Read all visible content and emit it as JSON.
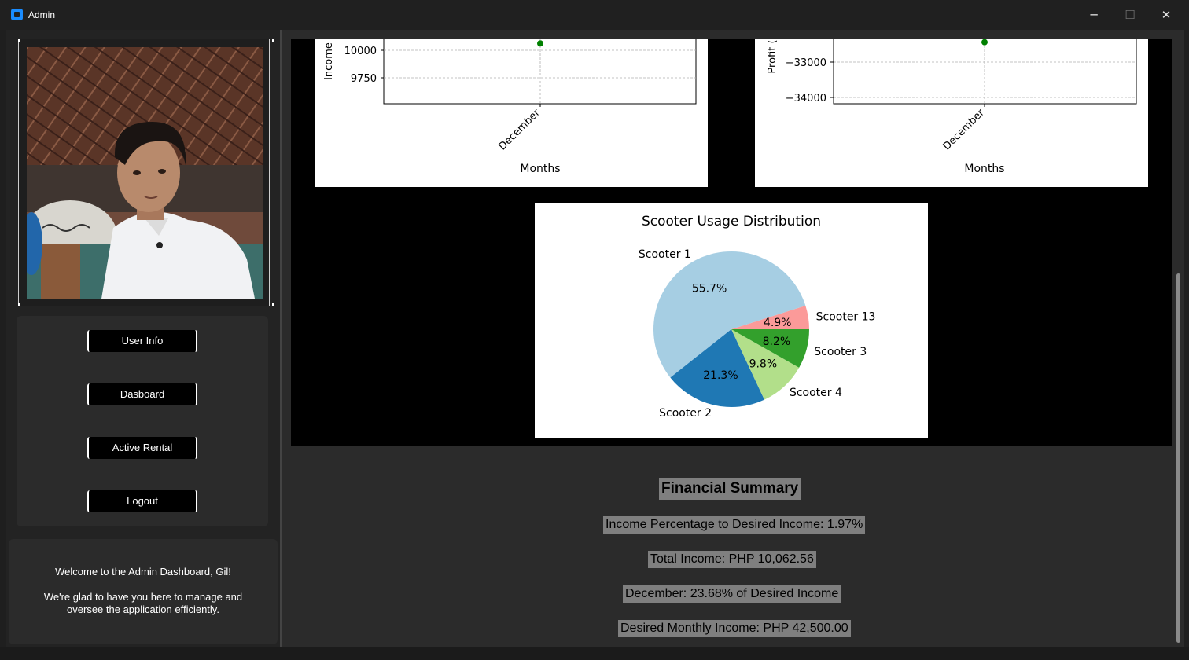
{
  "window": {
    "title": "Admin",
    "minimize_glyph": "─",
    "maximize_glyph": "☐",
    "close_glyph": "✕"
  },
  "sidebar": {
    "profile_photo_alt": "Admin profile photo",
    "nav": [
      {
        "label": "User Info"
      },
      {
        "label": "Dasboard"
      },
      {
        "label": "Active Rental"
      },
      {
        "label": "Logout"
      }
    ],
    "welcome_line1": "Welcome to the Admin Dashboard, Gil!",
    "welcome_line2": "We're glad to have you here to manage and oversee the application efficiently."
  },
  "chart_data": [
    {
      "type": "line",
      "title": "",
      "ylabel": "Income",
      "xlabel": "Months",
      "x": [
        "December"
      ],
      "series": [
        {
          "values": [
            10062.56
          ],
          "color": "#008000"
        }
      ],
      "y_ticks": [
        9750,
        10000
      ],
      "grid": true
    },
    {
      "type": "line",
      "title": "",
      "ylabel": "Profit (",
      "xlabel": "Months",
      "x": [
        "December"
      ],
      "series": [
        {
          "values": [
            -32437.44
          ],
          "color": "#008000"
        }
      ],
      "y_ticks": [
        -34000,
        -33000
      ],
      "y_tick_labels": [
        "−34000",
        "−33000"
      ],
      "grid": true
    },
    {
      "type": "pie",
      "title": "Scooter Usage Distribution",
      "slices": [
        {
          "label": "Scooter 1",
          "value": 55.7,
          "pct_label": "55.7%",
          "color": "#a6cee3"
        },
        {
          "label": "Scooter 2",
          "value": 21.3,
          "pct_label": "21.3%",
          "color": "#1f78b4"
        },
        {
          "label": "Scooter 4",
          "value": 9.8,
          "pct_label": "9.8%",
          "color": "#b2df8a"
        },
        {
          "label": "Scooter 3",
          "value": 8.2,
          "pct_label": "8.2%",
          "color": "#33a02c"
        },
        {
          "label": "Scooter 13",
          "value": 4.9,
          "pct_label": "4.9%",
          "color": "#fb9a99"
        }
      ]
    }
  ],
  "summary": {
    "title": "Financial Summary",
    "lines": [
      "Income Percentage to Desired Income: 1.97%",
      "Total Income: PHP 10,062.56",
      "December: 23.68% of Desired Income",
      "Desired Monthly Income: PHP 42,500.00"
    ]
  }
}
